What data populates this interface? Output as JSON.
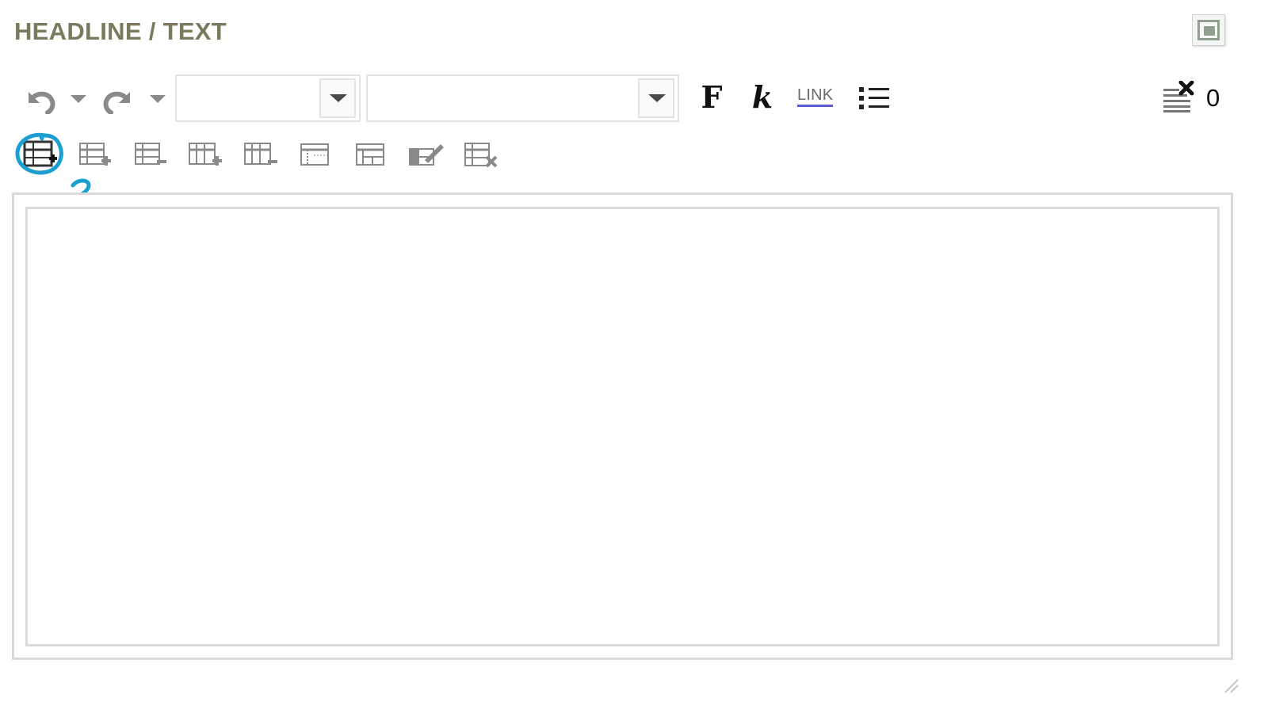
{
  "header": {
    "title": "HEADLINE / TEXT"
  },
  "toolbar": {
    "format_combo": {
      "value": ""
    },
    "style_combo": {
      "value": ""
    },
    "bold_label": "F",
    "italic_label": "k",
    "link_label": "LINK",
    "counter_value": "0"
  },
  "annotation": {
    "label": "2",
    "color": "#1a9fd0"
  },
  "editor": {
    "content": ""
  },
  "icons": {
    "undo": "undo-icon",
    "undo_dropdown": "chevron-down-icon",
    "redo": "redo-icon",
    "redo_dropdown": "chevron-down-icon",
    "bullet_list": "bullet-list-icon",
    "clear_formatting": "clear-formatting-icon",
    "maximize": "maximize-icon",
    "table_insert": "table-insert-icon",
    "row_insert": "table-row-insert-icon",
    "row_delete": "table-row-delete-icon",
    "column_insert": "table-column-insert-icon",
    "column_delete": "table-column-delete-icon",
    "merge_cells": "table-merge-cells-icon",
    "split_cells": "table-split-cells-icon",
    "cell_properties": "table-cell-properties-icon",
    "table_delete": "table-delete-icon"
  },
  "colors": {
    "title": "#7b7a5f",
    "icon_gray": "#8a8a8a",
    "border": "#dadada",
    "link_underline": "#5b5bd8"
  }
}
